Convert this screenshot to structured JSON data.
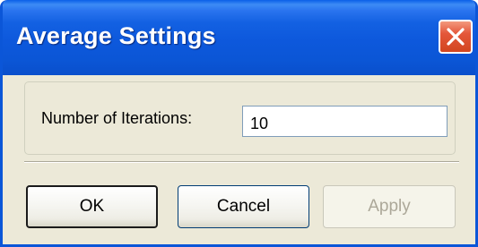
{
  "dialog": {
    "title": "Average Settings",
    "close_icon": "close-icon"
  },
  "form": {
    "iterations_label": "Number of Iterations:",
    "iterations_value": "10"
  },
  "buttons": {
    "ok_label": "OK",
    "cancel_label": "Cancel",
    "apply_label": "Apply",
    "apply_enabled": false
  },
  "colors": {
    "titlebar": "#0b56d6",
    "close_button": "#e4573a",
    "dialog_background": "#ece9d8"
  }
}
